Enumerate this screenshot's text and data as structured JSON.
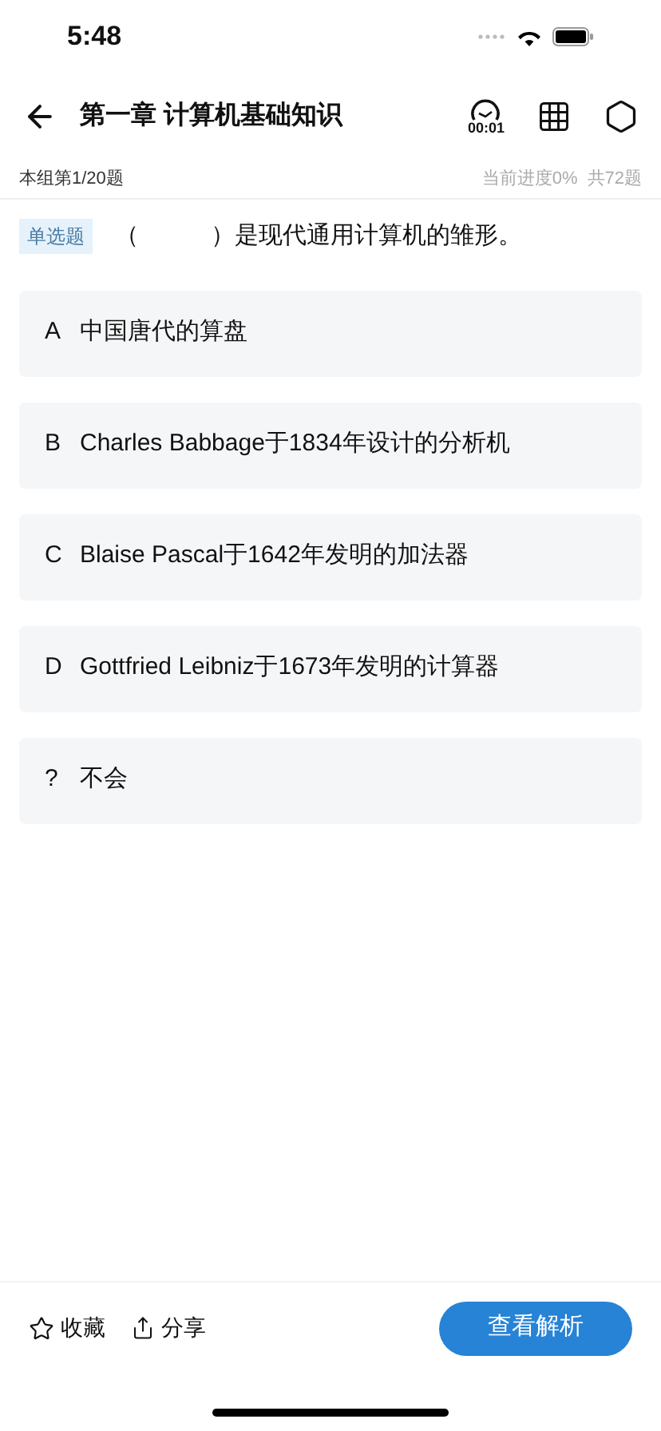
{
  "status_bar": {
    "time": "5:48"
  },
  "header": {
    "title": "第一章 计算机基础知识",
    "timer": "00:01"
  },
  "progress": {
    "group": "本组第1/20题",
    "current": "当前进度0%",
    "total": "共72题"
  },
  "question": {
    "type": "单选题",
    "text": "（　　　）是现代通用计算机的雏形。"
  },
  "options": [
    {
      "key": "A",
      "text": "中国唐代的算盘"
    },
    {
      "key": "B",
      "text": "Charles Babbage于1834年设计的分析机"
    },
    {
      "key": "C",
      "text": "Blaise Pascal于1642年发明的加法器"
    },
    {
      "key": "D",
      "text": "Gottfried Leibniz于1673年发明的计算器"
    },
    {
      "key": "?",
      "text": "不会"
    }
  ],
  "footer": {
    "favorite": "收藏",
    "share": "分享",
    "analysis": "查看解析"
  }
}
